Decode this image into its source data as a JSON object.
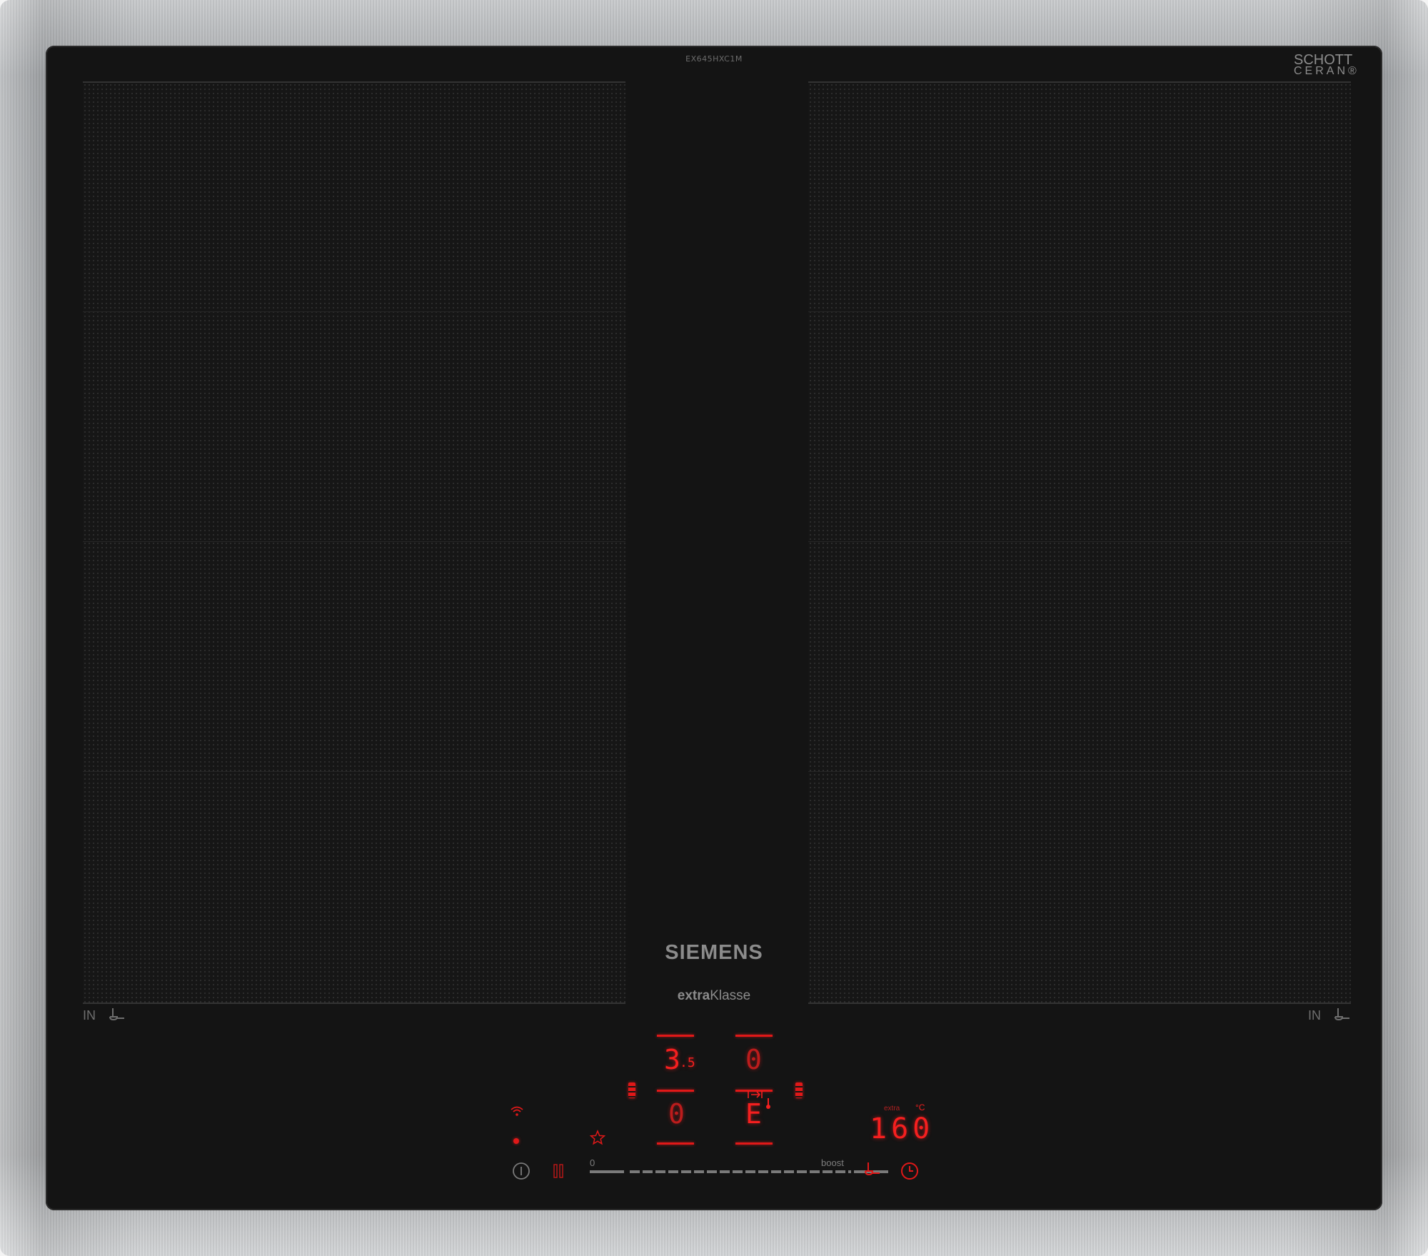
{
  "model_code": "EX645HXC1M",
  "schott_line1": "SCHOTT",
  "schott_line2": "CERAN®",
  "brand": "SIEMENS",
  "subbrand_bold": "extra",
  "subbrand_rest": "Klasse",
  "zone_left_label": "IN",
  "zone_right_label": "IN",
  "display_front_left_value": "3",
  "display_front_left_fraction": ".5",
  "display_front_right_value": "0",
  "display_rear_left_value": "0",
  "display_rear_right_value": "E",
  "temperature_value": "160",
  "temperature_mode": "extra",
  "temperature_unit": "°C",
  "slider_min_label": "0",
  "slider_max_label": "boost",
  "colors": {
    "frame": "#b4b6b8",
    "glass": "#141414",
    "display_red": "#f51f1f",
    "printing_grey": "#8b8b8b"
  },
  "icons": [
    "wifi-icon",
    "status-dot-icon",
    "favorite-star-icon",
    "power-icon",
    "pause-icon",
    "pan-sensor-icon",
    "timer-icon"
  ]
}
